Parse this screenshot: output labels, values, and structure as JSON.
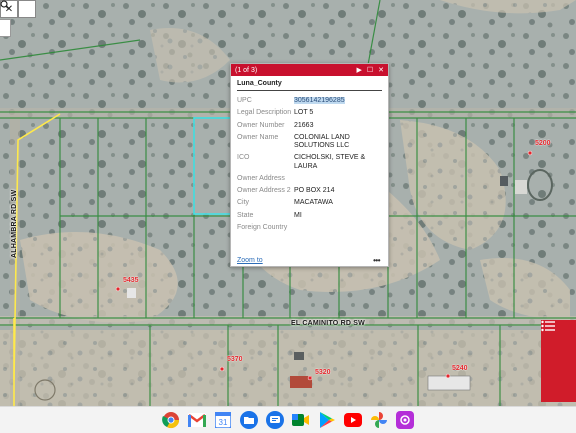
{
  "toolbar": {
    "close_icon": "close-icon",
    "search_icon": "search-icon"
  },
  "popup": {
    "counter": "(1 of 3)",
    "layer_title": "Luna_County",
    "fields": [
      {
        "key": "UPC",
        "value": "3056142196285"
      },
      {
        "key": "Legal Description",
        "value": "LOT 5"
      },
      {
        "key": "Owner Number",
        "value": "21663"
      },
      {
        "key": "Owner Name",
        "value": "COLONIAL LAND SOLUTIONS LLC"
      },
      {
        "key": "ICO",
        "value": "CICHOLSKI, STEVE & LAURA"
      },
      {
        "key": "Owner Address",
        "value": ""
      },
      {
        "key": "Owner Address 2",
        "value": "PO BOX 214"
      },
      {
        "key": "City",
        "value": "MACATAWA"
      },
      {
        "key": "State",
        "value": "MI"
      },
      {
        "key": "Foreign Country",
        "value": ""
      }
    ],
    "zoom_label": "Zoom to",
    "more_label": "•••",
    "header_color": "#c8102e"
  },
  "map": {
    "roads": {
      "vertical": "ALHAMBRA RD SW",
      "horizontal": "EL CAMINITO RD SW"
    },
    "addresses": [
      "5200",
      "5435",
      "5370",
      "5320",
      "5240"
    ],
    "parcel_line_color": "#2f8a3a",
    "road_color": "#ffe94a",
    "selection_color": "#45e0e6"
  },
  "legend_button": {
    "icon": "list-icon",
    "color": "#d01c2a"
  },
  "shelf": {
    "apps": [
      "chrome-icon",
      "gmail-icon",
      "calendar-icon",
      "files-icon",
      "messages-icon",
      "meet-icon",
      "play-store-icon",
      "youtube-icon",
      "photos-icon",
      "podcasts-icon"
    ]
  }
}
